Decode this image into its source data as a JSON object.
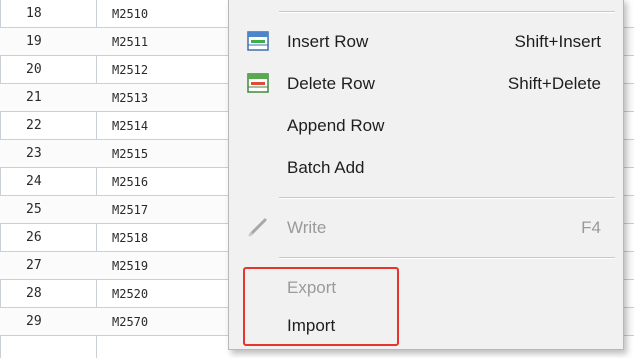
{
  "table": {
    "rows": [
      {
        "num": "18",
        "addr": "M2510"
      },
      {
        "num": "19",
        "addr": "M2511"
      },
      {
        "num": "20",
        "addr": "M2512"
      },
      {
        "num": "21",
        "addr": "M2513"
      },
      {
        "num": "22",
        "addr": "M2514"
      },
      {
        "num": "23",
        "addr": "M2515"
      },
      {
        "num": "24",
        "addr": "M2516"
      },
      {
        "num": "25",
        "addr": "M2517"
      },
      {
        "num": "26",
        "addr": "M2518"
      },
      {
        "num": "27",
        "addr": "M2519"
      },
      {
        "num": "28",
        "addr": "M2520"
      },
      {
        "num": "29",
        "addr": "M2570"
      }
    ]
  },
  "context_menu": {
    "items": [
      {
        "label": "Insert Row",
        "shortcut": "Shift+Insert",
        "icon": "insert-row-icon",
        "enabled": true
      },
      {
        "label": "Delete Row",
        "shortcut": "Shift+Delete",
        "icon": "delete-row-icon",
        "enabled": true
      },
      {
        "label": "Append Row",
        "shortcut": "",
        "icon": "",
        "enabled": true
      },
      {
        "label": "Batch Add",
        "shortcut": "",
        "icon": "",
        "enabled": true
      },
      {
        "label": "Write",
        "shortcut": "F4",
        "icon": "pencil-icon",
        "enabled": false
      },
      {
        "label": "Export",
        "shortcut": "",
        "icon": "",
        "enabled": false
      },
      {
        "label": "Import",
        "shortcut": "",
        "icon": "",
        "enabled": true
      }
    ],
    "highlight_color": "#e8342e"
  }
}
